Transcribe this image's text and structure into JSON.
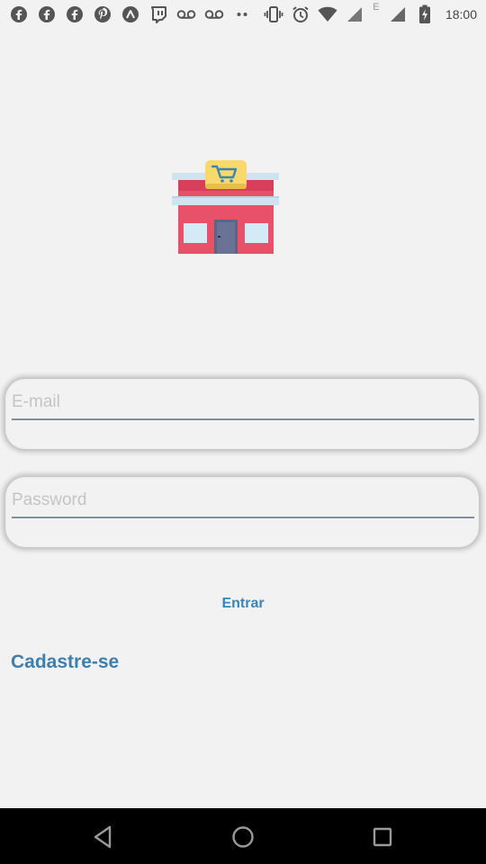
{
  "status_bar": {
    "left_icons": [
      "facebook-icon",
      "facebook-icon",
      "facebook-icon",
      "pinterest-icon",
      "arrow-app-icon",
      "twitch-icon",
      "voicemail-icon",
      "voicemail-icon",
      "more-dots-icon"
    ],
    "right_icons": [
      "vibrate-icon",
      "alarm-icon",
      "wifi-icon",
      "signal-icon",
      "signal-icon",
      "battery-charging-icon"
    ],
    "network_label": "E",
    "time": "18:00"
  },
  "logo": {
    "icon": "store-cart-icon"
  },
  "form": {
    "email_placeholder": "E-mail",
    "email_value": "",
    "password_placeholder": "Password",
    "password_value": ""
  },
  "actions": {
    "login_label": "Entrar",
    "signup_label": "Cadastre-se"
  },
  "colors": {
    "background": "#f2f2f2",
    "accent": "#3a85b6",
    "store_red": "#e8516a",
    "store_sign": "#f9d96b"
  },
  "nav_bar": {
    "buttons": [
      "back-icon",
      "home-icon",
      "recent-apps-icon"
    ]
  }
}
